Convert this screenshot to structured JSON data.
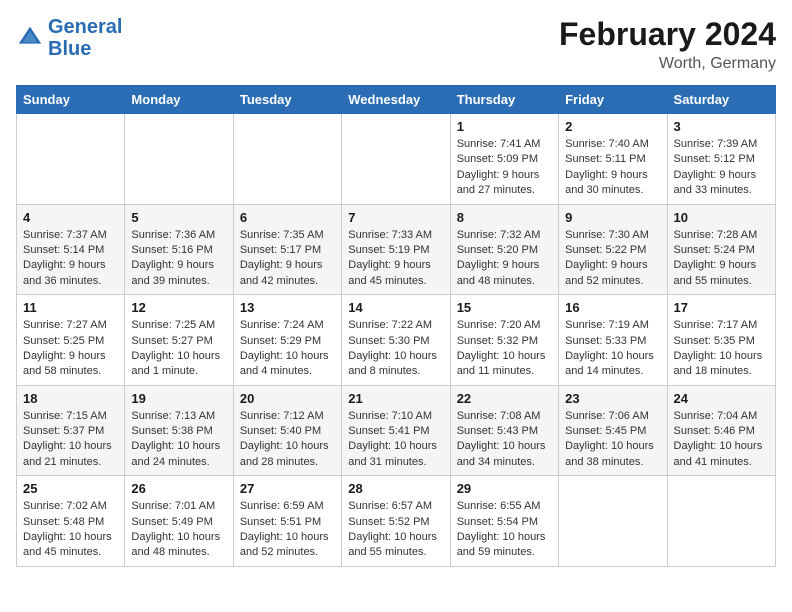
{
  "header": {
    "logo_line1": "General",
    "logo_line2": "Blue",
    "main_title": "February 2024",
    "subtitle": "Worth, Germany"
  },
  "days_of_week": [
    "Sunday",
    "Monday",
    "Tuesday",
    "Wednesday",
    "Thursday",
    "Friday",
    "Saturday"
  ],
  "weeks": [
    [
      {
        "day": "",
        "content": ""
      },
      {
        "day": "",
        "content": ""
      },
      {
        "day": "",
        "content": ""
      },
      {
        "day": "",
        "content": ""
      },
      {
        "day": "1",
        "content": "Sunrise: 7:41 AM\nSunset: 5:09 PM\nDaylight: 9 hours and 27 minutes."
      },
      {
        "day": "2",
        "content": "Sunrise: 7:40 AM\nSunset: 5:11 PM\nDaylight: 9 hours and 30 minutes."
      },
      {
        "day": "3",
        "content": "Sunrise: 7:39 AM\nSunset: 5:12 PM\nDaylight: 9 hours and 33 minutes."
      }
    ],
    [
      {
        "day": "4",
        "content": "Sunrise: 7:37 AM\nSunset: 5:14 PM\nDaylight: 9 hours and 36 minutes."
      },
      {
        "day": "5",
        "content": "Sunrise: 7:36 AM\nSunset: 5:16 PM\nDaylight: 9 hours and 39 minutes."
      },
      {
        "day": "6",
        "content": "Sunrise: 7:35 AM\nSunset: 5:17 PM\nDaylight: 9 hours and 42 minutes."
      },
      {
        "day": "7",
        "content": "Sunrise: 7:33 AM\nSunset: 5:19 PM\nDaylight: 9 hours and 45 minutes."
      },
      {
        "day": "8",
        "content": "Sunrise: 7:32 AM\nSunset: 5:20 PM\nDaylight: 9 hours and 48 minutes."
      },
      {
        "day": "9",
        "content": "Sunrise: 7:30 AM\nSunset: 5:22 PM\nDaylight: 9 hours and 52 minutes."
      },
      {
        "day": "10",
        "content": "Sunrise: 7:28 AM\nSunset: 5:24 PM\nDaylight: 9 hours and 55 minutes."
      }
    ],
    [
      {
        "day": "11",
        "content": "Sunrise: 7:27 AM\nSunset: 5:25 PM\nDaylight: 9 hours and 58 minutes."
      },
      {
        "day": "12",
        "content": "Sunrise: 7:25 AM\nSunset: 5:27 PM\nDaylight: 10 hours and 1 minute."
      },
      {
        "day": "13",
        "content": "Sunrise: 7:24 AM\nSunset: 5:29 PM\nDaylight: 10 hours and 4 minutes."
      },
      {
        "day": "14",
        "content": "Sunrise: 7:22 AM\nSunset: 5:30 PM\nDaylight: 10 hours and 8 minutes."
      },
      {
        "day": "15",
        "content": "Sunrise: 7:20 AM\nSunset: 5:32 PM\nDaylight: 10 hours and 11 minutes."
      },
      {
        "day": "16",
        "content": "Sunrise: 7:19 AM\nSunset: 5:33 PM\nDaylight: 10 hours and 14 minutes."
      },
      {
        "day": "17",
        "content": "Sunrise: 7:17 AM\nSunset: 5:35 PM\nDaylight: 10 hours and 18 minutes."
      }
    ],
    [
      {
        "day": "18",
        "content": "Sunrise: 7:15 AM\nSunset: 5:37 PM\nDaylight: 10 hours and 21 minutes."
      },
      {
        "day": "19",
        "content": "Sunrise: 7:13 AM\nSunset: 5:38 PM\nDaylight: 10 hours and 24 minutes."
      },
      {
        "day": "20",
        "content": "Sunrise: 7:12 AM\nSunset: 5:40 PM\nDaylight: 10 hours and 28 minutes."
      },
      {
        "day": "21",
        "content": "Sunrise: 7:10 AM\nSunset: 5:41 PM\nDaylight: 10 hours and 31 minutes."
      },
      {
        "day": "22",
        "content": "Sunrise: 7:08 AM\nSunset: 5:43 PM\nDaylight: 10 hours and 34 minutes."
      },
      {
        "day": "23",
        "content": "Sunrise: 7:06 AM\nSunset: 5:45 PM\nDaylight: 10 hours and 38 minutes."
      },
      {
        "day": "24",
        "content": "Sunrise: 7:04 AM\nSunset: 5:46 PM\nDaylight: 10 hours and 41 minutes."
      }
    ],
    [
      {
        "day": "25",
        "content": "Sunrise: 7:02 AM\nSunset: 5:48 PM\nDaylight: 10 hours and 45 minutes."
      },
      {
        "day": "26",
        "content": "Sunrise: 7:01 AM\nSunset: 5:49 PM\nDaylight: 10 hours and 48 minutes."
      },
      {
        "day": "27",
        "content": "Sunrise: 6:59 AM\nSunset: 5:51 PM\nDaylight: 10 hours and 52 minutes."
      },
      {
        "day": "28",
        "content": "Sunrise: 6:57 AM\nSunset: 5:52 PM\nDaylight: 10 hours and 55 minutes."
      },
      {
        "day": "29",
        "content": "Sunrise: 6:55 AM\nSunset: 5:54 PM\nDaylight: 10 hours and 59 minutes."
      },
      {
        "day": "",
        "content": ""
      },
      {
        "day": "",
        "content": ""
      }
    ]
  ]
}
